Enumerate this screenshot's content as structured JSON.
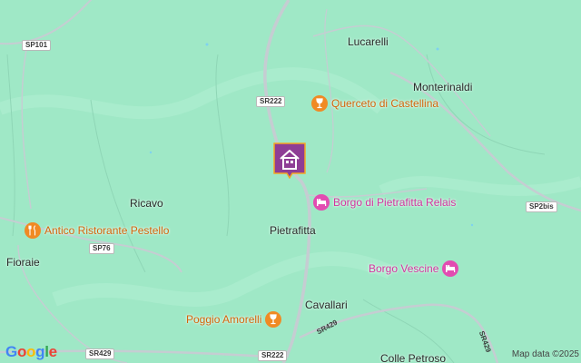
{
  "map": {
    "places": [
      {
        "id": "lucarelli",
        "name": "Lucarelli"
      },
      {
        "id": "monterinaldi",
        "name": "Monterinaldi"
      },
      {
        "id": "ricavo",
        "name": "Ricavo"
      },
      {
        "id": "pietrafitta",
        "name": "Pietrafitta"
      },
      {
        "id": "fioraie",
        "name": "Fioraie"
      },
      {
        "id": "cavallari",
        "name": "Cavallari"
      },
      {
        "id": "colle-petroso",
        "name": "Colle Petroso"
      }
    ],
    "road_labels": [
      "SP101",
      "SR222",
      "SP76",
      "SR429",
      "SR222",
      "SP2bis",
      "SR429",
      "SR429"
    ],
    "pois": [
      {
        "name": "Querceto di Castellina",
        "category": "winery",
        "icon": "wine-glass-icon",
        "color": "#f08a24"
      },
      {
        "name": "Borgo di Pietrafitta Relais",
        "category": "hotel",
        "icon": "bed-icon",
        "color": "#e24cb1"
      },
      {
        "name": "Antico Ristorante Pestello",
        "category": "restaurant",
        "icon": "fork-knife-icon",
        "color": "#f08a24"
      },
      {
        "name": "Borgo Vescine",
        "category": "hotel",
        "icon": "bed-icon",
        "color": "#e24cb1"
      },
      {
        "name": "Poggio Amorelli",
        "category": "winery",
        "icon": "wine-glass-icon",
        "color": "#f08a24"
      }
    ],
    "home_marker": {
      "icon": "home-icon",
      "color": "#8e3d95"
    }
  },
  "branding": {
    "logo": "Google",
    "logo_letters": [
      "G",
      "o",
      "o",
      "g",
      "l",
      "e"
    ]
  },
  "attribution": "Map data ©2025",
  "colors": {
    "land": "#9fe8c6",
    "road": "#c5cdd2",
    "poi_orange": "#f08a24",
    "poi_pink": "#e24cb1",
    "marker_purple": "#8e3d95"
  }
}
